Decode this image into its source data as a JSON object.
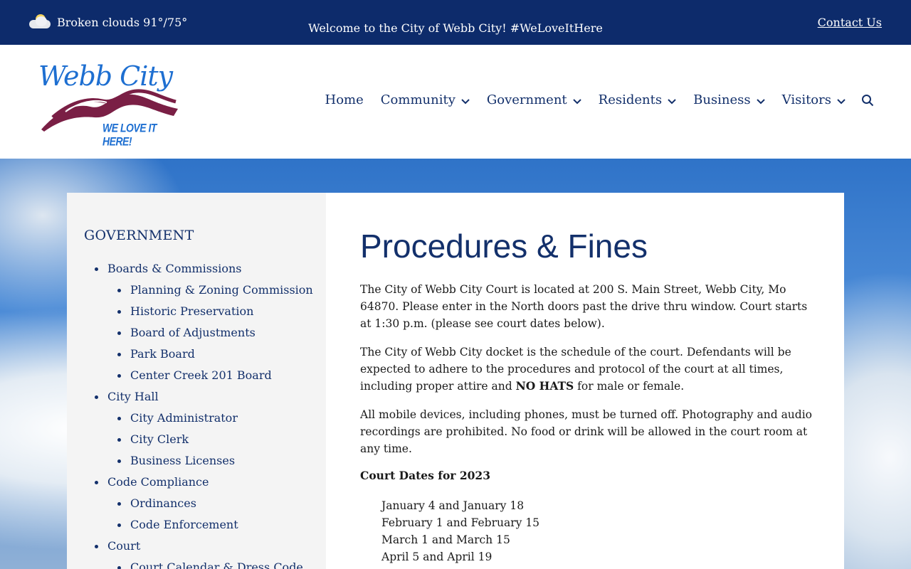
{
  "topbar": {
    "weather": "Broken clouds 91°/75°",
    "welcome": "Welcome to the City of Webb City! #WeLoveItHere",
    "contact": "Contact Us"
  },
  "logo": {
    "title": "Webb City",
    "tagline": "WE LOVE IT HERE!"
  },
  "nav": {
    "items": [
      "Home",
      "Community",
      "Government",
      "Residents",
      "Business",
      "Visitors"
    ]
  },
  "sidebar": {
    "title": "GOVERNMENT",
    "items": [
      {
        "label": "Boards & Commissions",
        "level": 1
      },
      {
        "label": "Planning & Zoning Commission",
        "level": 2
      },
      {
        "label": "Historic Preservation",
        "level": 2
      },
      {
        "label": "Board of Adjustments",
        "level": 2
      },
      {
        "label": "Park Board",
        "level": 2
      },
      {
        "label": "Center Creek 201 Board",
        "level": 2
      },
      {
        "label": "City Hall",
        "level": 1
      },
      {
        "label": "City Administrator",
        "level": 2
      },
      {
        "label": "City Clerk",
        "level": 2
      },
      {
        "label": "Business Licenses",
        "level": 2
      },
      {
        "label": "Code Compliance",
        "level": 1
      },
      {
        "label": "Ordinances",
        "level": 2
      },
      {
        "label": "Code Enforcement",
        "level": 2
      },
      {
        "label": "Court",
        "level": 1
      },
      {
        "label": "Court Calendar & Dress Code",
        "level": 2
      }
    ]
  },
  "main": {
    "title": "Procedures & Fines",
    "p1": "The City of Webb City Court is located at 200 S. Main Street, Webb City, Mo 64870. Please enter in the North doors past the drive thru window. Court starts at 1:30 p.m. (please see court dates below).",
    "p2_before": "The City of Webb City docket is the schedule of the court. Defendants will be expected to adhere to the procedures and protocol of the court at all times, including proper attire and ",
    "p2_bold": "NO HATS",
    "p2_after": " for male or female.",
    "p3": "All mobile devices, including phones, must be turned off. Photography and audio recordings are prohibited. No food or drink will be allowed in the court room at any time.",
    "dates_heading": "Court Dates for 2023",
    "dates": [
      "January 4 and January 18",
      "February 1 and February 15",
      "March 1 and March 15",
      "April 5 and April 19"
    ]
  }
}
